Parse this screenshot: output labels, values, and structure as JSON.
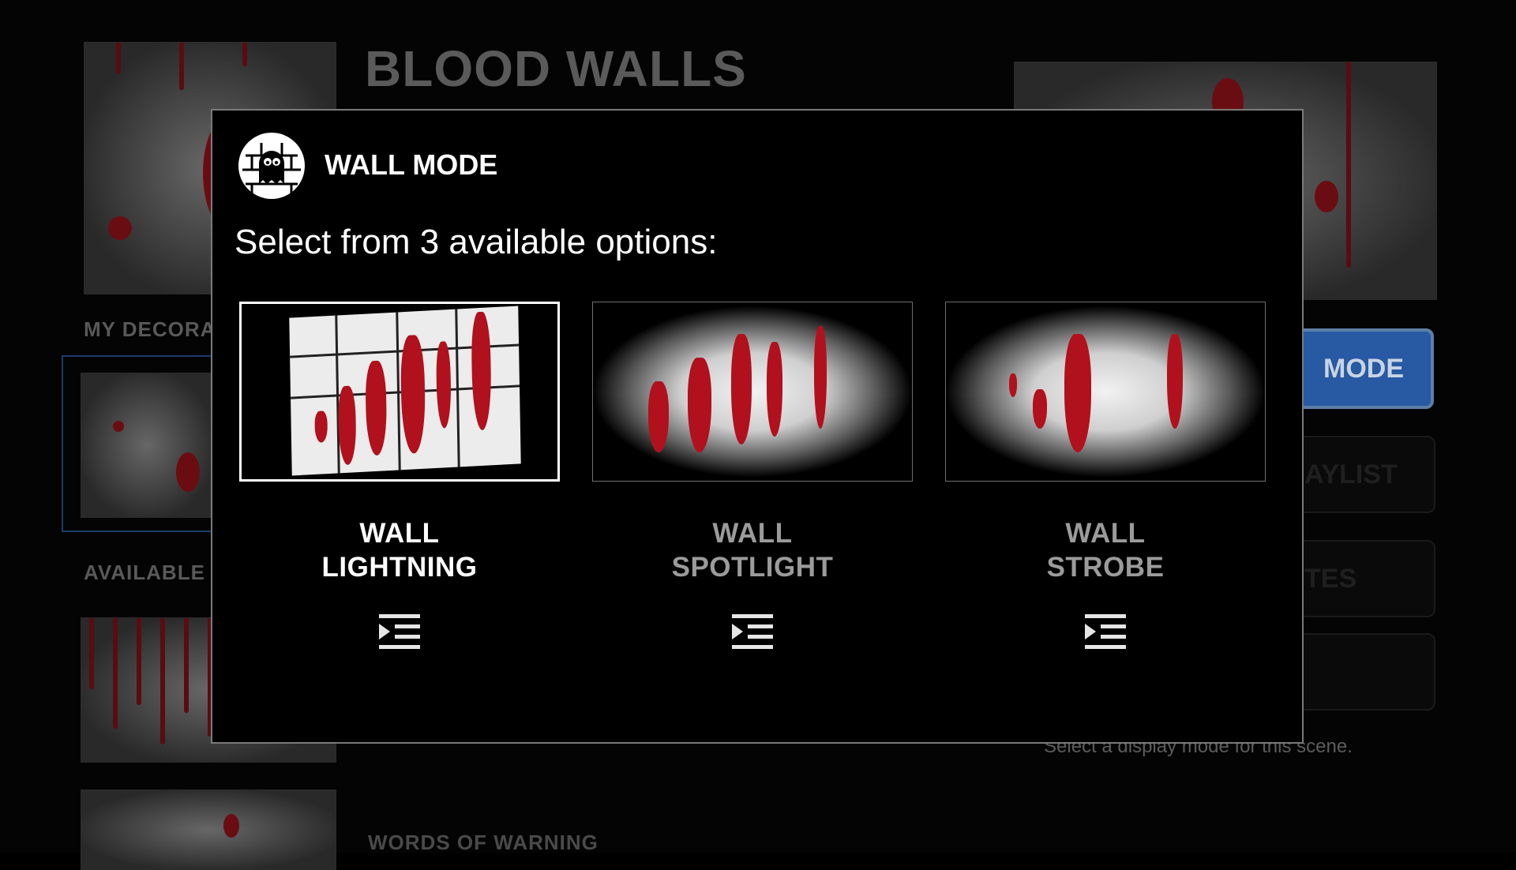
{
  "background": {
    "page_title": "BLOOD WALLS",
    "section_my_decorations": "MY DECORA",
    "section_available": "AVAILABLE F",
    "section_words_of_warning": "WORDS OF WARNING",
    "mode_button_label": "MODE",
    "playlist_button_label": "AYLIST",
    "favorites_button_label": "TES",
    "help_text": "Select a display mode for this scene."
  },
  "modal": {
    "icon": "ghost-brick-wall-icon",
    "title": "WALL MODE",
    "subtitle": "Select from 3 available options:",
    "options": [
      {
        "line1": "WALL",
        "line2": "LIGHTNING",
        "selected": true,
        "info_icon": "indent-list-icon"
      },
      {
        "line1": "WALL",
        "line2": "SPOTLIGHT",
        "selected": false,
        "info_icon": "indent-list-icon"
      },
      {
        "line1": "WALL",
        "line2": "STROBE",
        "selected": false,
        "info_icon": "indent-list-icon"
      }
    ]
  },
  "colors": {
    "accent_blue": "#275aa3",
    "blood_red": "#b0111d",
    "modal_border": "#7a7a7a"
  }
}
